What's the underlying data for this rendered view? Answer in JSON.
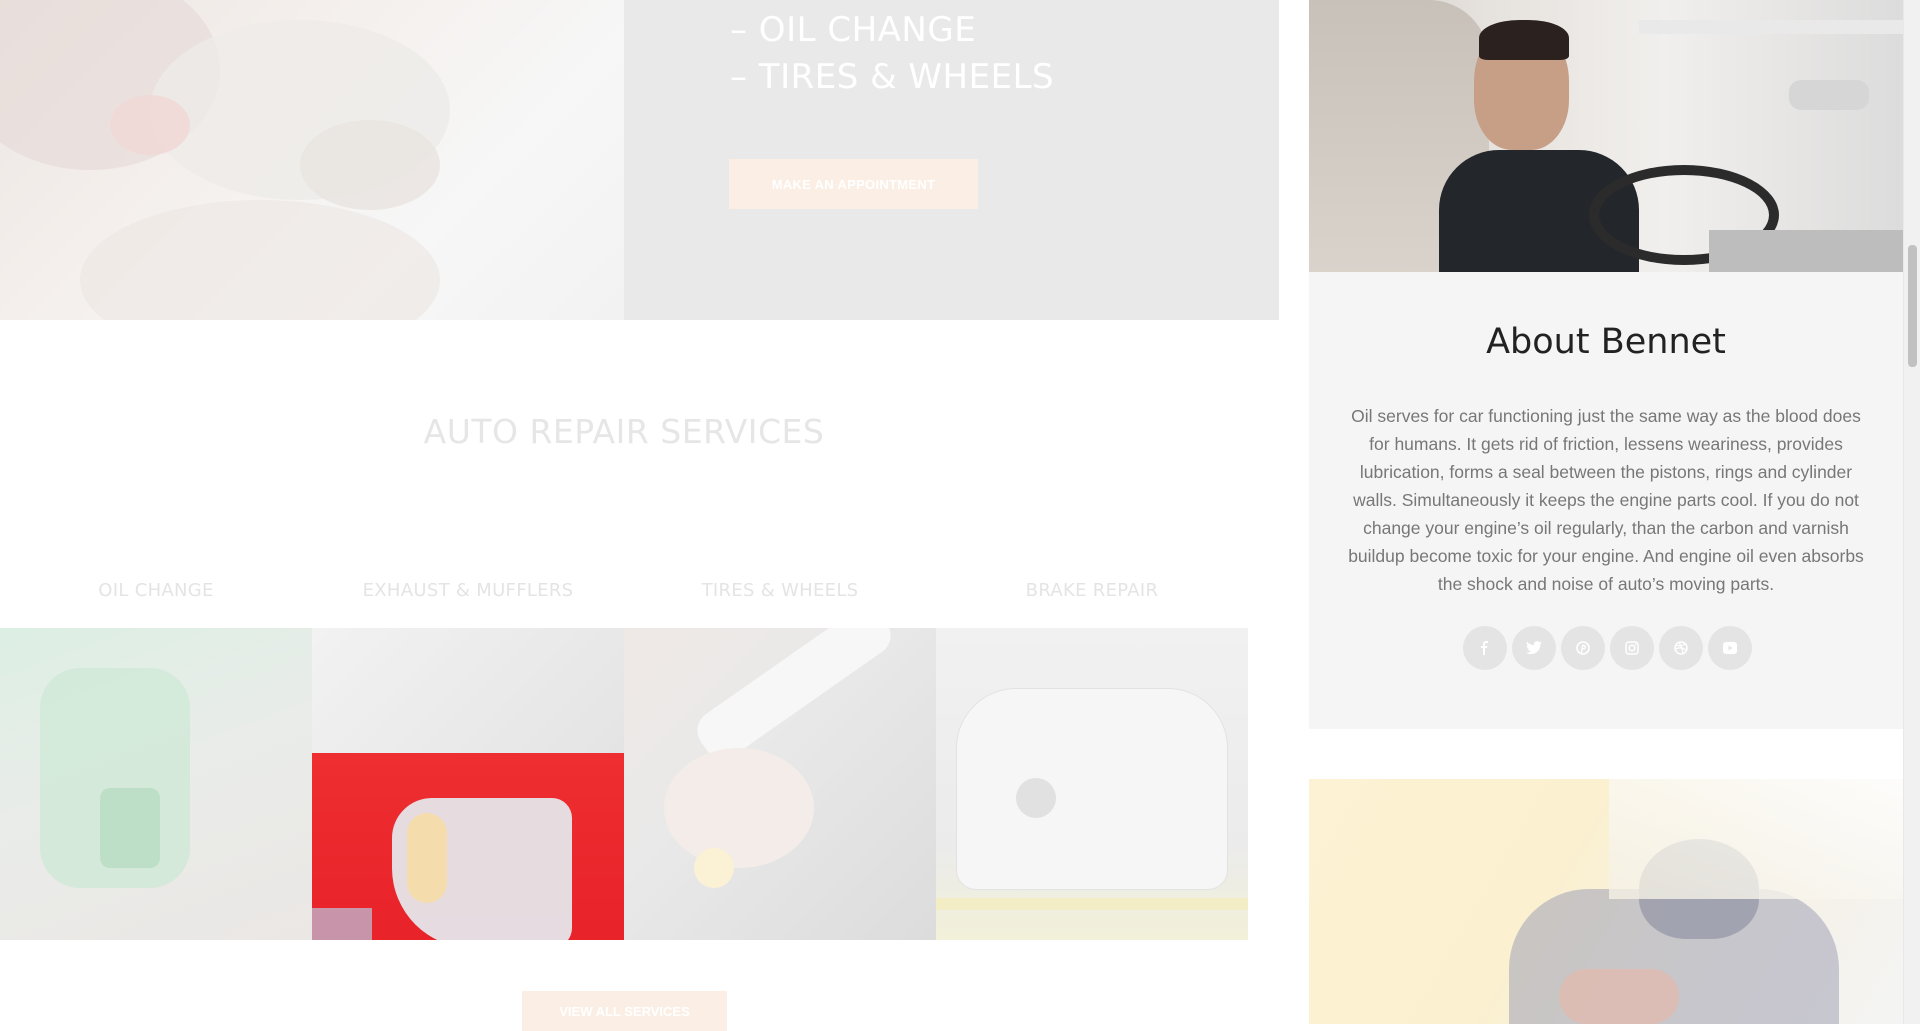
{
  "hero": {
    "lines": [
      "– OIL CHANGE",
      "– TIRES & WHEELS"
    ],
    "appointment_button": "MAKE AN APPOINTMENT"
  },
  "services": {
    "title": "AUTO REPAIR SERVICES",
    "items": [
      {
        "label": "OIL CHANGE"
      },
      {
        "label": "EXHAUST & MUFFLERS"
      },
      {
        "label": "TIRES & WHEELS"
      },
      {
        "label": "BRAKE REPAIR"
      }
    ],
    "view_all_button": "VIEW ALL SERVICES"
  },
  "sidebar": {
    "about_title": "About Bennet",
    "about_text": "Oil serves for car functioning just the same way as the blood does for humans. It gets rid of friction, lessens weariness, provides lubrication, forms a seal between the pistons, rings and cylinder walls. Simultaneously it keeps the engine parts cool. If you do not change your engine’s oil regularly, than the carbon and varnish buildup become toxic for your engine. And engine oil even absorbs the shock and noise of auto’s moving parts.",
    "social": [
      "facebook-icon",
      "twitter-icon",
      "pinterest-icon",
      "instagram-icon",
      "dribbble-icon",
      "youtube-icon"
    ]
  }
}
